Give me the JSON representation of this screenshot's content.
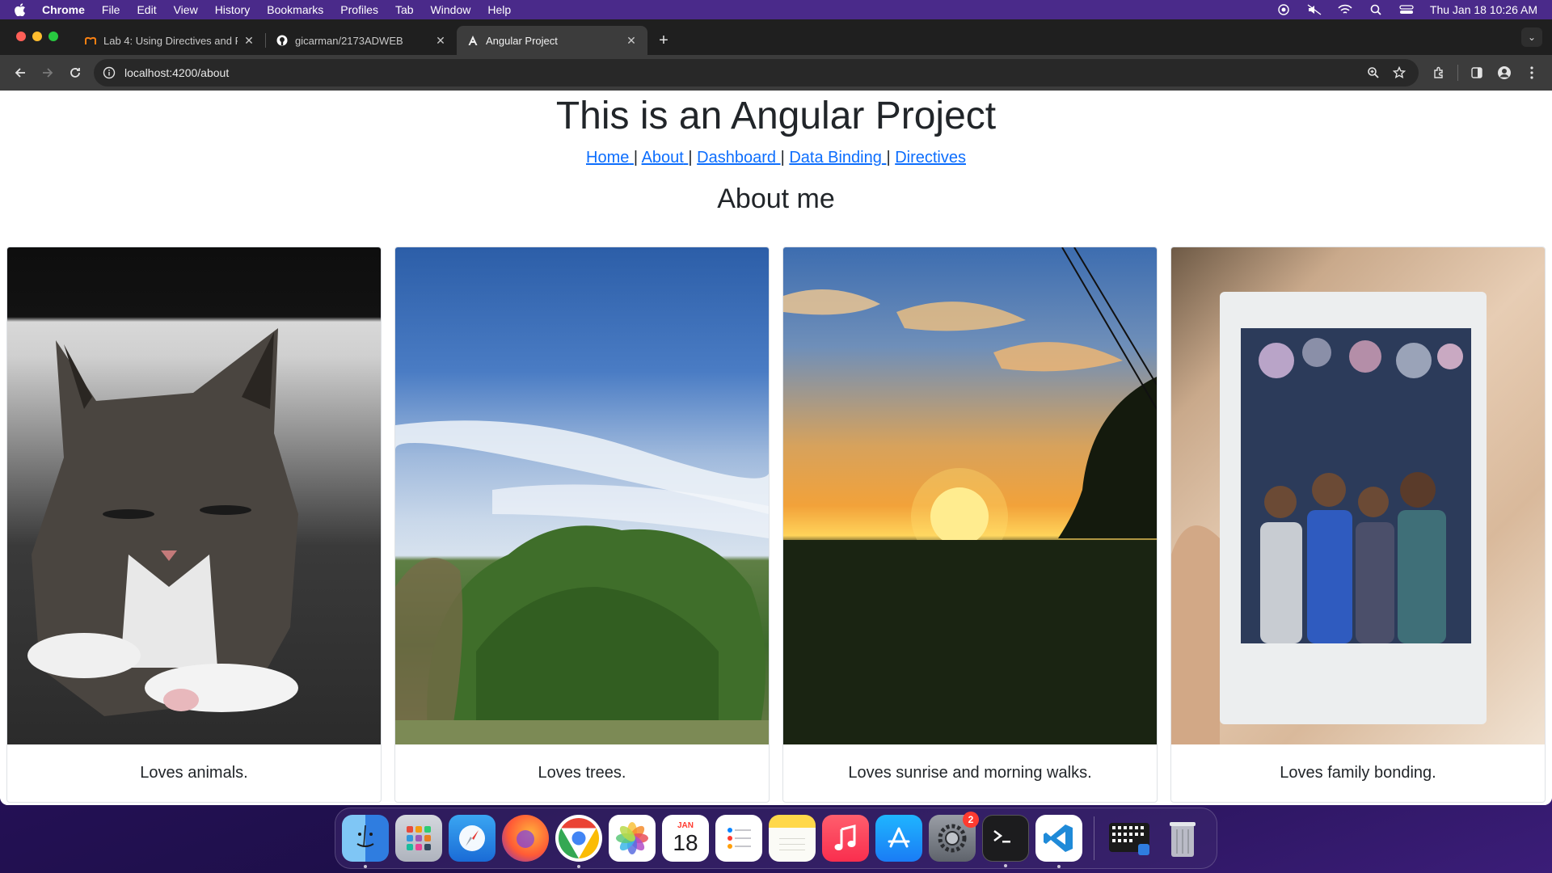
{
  "menubar": {
    "app_name": "Chrome",
    "items": [
      "File",
      "Edit",
      "View",
      "History",
      "Bookmarks",
      "Profiles",
      "Tab",
      "Window",
      "Help"
    ],
    "clock": "Thu Jan 18  10:26 AM"
  },
  "browser": {
    "tabs": [
      {
        "title": "Lab 4: Using Directives and F",
        "favicon": "moodle-icon"
      },
      {
        "title": "gicarman/2173ADWEB",
        "favicon": "github-icon"
      },
      {
        "title": "Angular Project",
        "favicon": "angular-icon"
      }
    ],
    "url": "localhost:4200/about"
  },
  "page": {
    "title": "This is an Angular Project",
    "nav": [
      "Home",
      "About",
      "Dashboard",
      "Data Binding",
      "Directives"
    ],
    "separator": "|",
    "section_title": "About me",
    "cards": [
      {
        "caption": "Loves animals.",
        "photo": "cat-photo"
      },
      {
        "caption": "Loves trees.",
        "photo": "tree-sky-photo"
      },
      {
        "caption": "Loves sunrise and morning walks.",
        "photo": "sunrise-photo"
      },
      {
        "caption": "Loves family bonding.",
        "photo": "family-instax-photo"
      }
    ]
  },
  "dock": {
    "apps": [
      "Finder",
      "Launchpad",
      "Safari",
      "Firefox",
      "Chrome",
      "Photos",
      "Calendar",
      "Reminders",
      "Notes",
      "Music",
      "App Store",
      "System Settings",
      "Terminal",
      "Visual Studio Code",
      "Screenshot",
      "Trash"
    ],
    "calendar_month": "JAN",
    "calendar_day": "18",
    "settings_badge": "2"
  },
  "colors": {
    "link": "#0d6efd",
    "text": "#212529",
    "chrome_dark": "#3c3c3c",
    "menubar": "#4a2a8a"
  }
}
